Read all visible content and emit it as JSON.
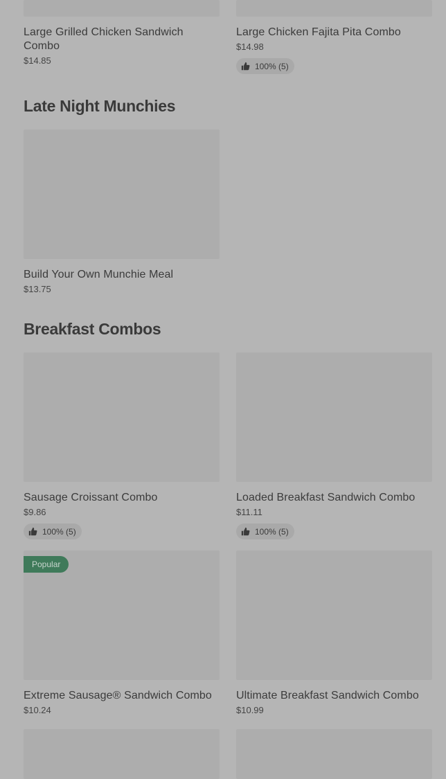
{
  "top_row": [
    {
      "title": "Large Grilled Chicken Sandwich Combo",
      "price": "$14.85"
    },
    {
      "title": "Large Chicken Fajita Pita Combo",
      "price": "$14.98",
      "rating": "100% (5)"
    }
  ],
  "late_night": {
    "heading": "Late Night Munchies",
    "items": [
      {
        "title": "Build Your Own Munchie Meal",
        "price": "$13.75"
      }
    ]
  },
  "breakfast": {
    "heading": "Breakfast Combos",
    "items": [
      {
        "title": "Sausage Croissant Combo",
        "price": "$9.86",
        "rating": "100% (5)"
      },
      {
        "title": "Loaded Breakfast Sandwich Combo",
        "price": "$11.11",
        "rating": "100% (5)"
      },
      {
        "title": "Extreme Sausage® Sandwich Combo",
        "price": "$10.24",
        "badge": "Popular"
      },
      {
        "title": "Ultimate Breakfast Sandwich Combo",
        "price": "$10.99"
      }
    ]
  },
  "icons": {
    "rating": "thumbs-up-icon"
  },
  "colors": {
    "background": "#b5b5b5",
    "image_placeholder": "#adadad",
    "popular_badge": "#3f7a5a"
  }
}
